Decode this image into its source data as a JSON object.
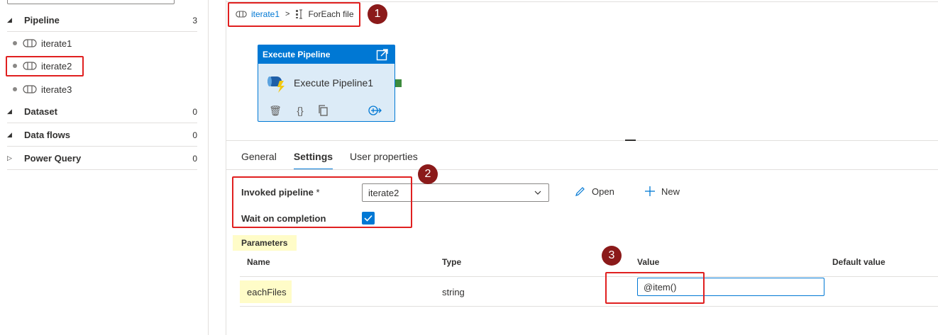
{
  "sidebar": {
    "groups": [
      {
        "label": "Pipeline",
        "count": "3",
        "caret": "◢"
      },
      {
        "label": "Dataset",
        "count": "0",
        "caret": "◢"
      },
      {
        "label": "Data flows",
        "count": "0",
        "caret": "◢"
      },
      {
        "label": "Power Query",
        "count": "0",
        "caret": "▷"
      }
    ],
    "pipelines": [
      {
        "label": "iterate1"
      },
      {
        "label": "iterate2"
      },
      {
        "label": "iterate3"
      }
    ]
  },
  "breadcrumb": {
    "parent": "iterate1",
    "separator": ">",
    "current": "ForEach file"
  },
  "badges": {
    "b1": "1",
    "b2": "2",
    "b3": "3"
  },
  "activity": {
    "header": "Execute Pipeline",
    "name": "Execute Pipeline1",
    "tools": {
      "delete": "🗑",
      "code": "{}"
    }
  },
  "tabs": [
    {
      "label": "General"
    },
    {
      "label": "Settings"
    },
    {
      "label": "User properties"
    }
  ],
  "settings": {
    "invoked_label": "Invoked pipeline",
    "required_mark": "*",
    "invoked_value": "iterate2",
    "open_label": "Open",
    "new_label": "New",
    "wait_label": "Wait on completion",
    "wait_checked": true
  },
  "parameters": {
    "section_label": "Parameters",
    "columns": [
      "Name",
      "Type",
      "Value",
      "Default value"
    ],
    "rows": [
      {
        "name": "eachFiles",
        "type": "string",
        "value": "@item()"
      }
    ]
  },
  "colors": {
    "accent": "#0078d4",
    "annotation_red": "#e02020",
    "badge": "#8b1a1a",
    "highlight": "#fffcc8"
  }
}
